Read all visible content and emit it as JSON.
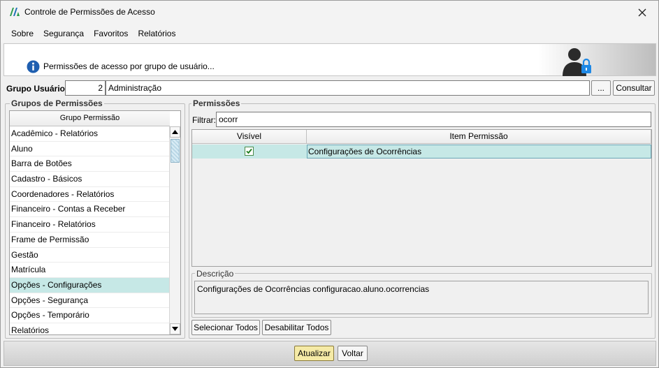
{
  "window": {
    "title": "Controle de Permissões de Acesso"
  },
  "menu": {
    "sobre": "Sobre",
    "seguranca": "Segurança",
    "favoritos": "Favoritos",
    "relatorios": "Relatórios"
  },
  "banner": {
    "text": "Permissões de acesso por grupo de usuário..."
  },
  "grupo_usuario": {
    "label": "Grupo Usuário:",
    "code": "2",
    "name": "Administração",
    "lookup_label": "...",
    "consultar_label": "Consultar"
  },
  "grupos": {
    "legend": "Grupos de Permissões",
    "column_header": "Grupo Permissão",
    "items": [
      "Acadêmico - Relatórios",
      "Aluno",
      "Barra de Botões",
      "Cadastro - Básicos",
      "Coordenadores - Relatórios",
      "Financeiro - Contas a Receber",
      "Financeiro - Relatórios",
      "Frame de Permissão",
      "Gestão",
      "Matrícula",
      "Opções - Configurações",
      "Opções - Segurança",
      "Opções - Temporário",
      "Relatórios"
    ],
    "selected_item": "Opções - Configurações"
  },
  "permissoes": {
    "legend": "Permissões",
    "filter_label": "Filtrar:",
    "filter_value": "ocorr",
    "columns": [
      "Visível",
      "Item Permissão"
    ],
    "rows": [
      {
        "visivel": true,
        "item": "Configurações de Ocorrências"
      }
    ]
  },
  "descricao": {
    "legend": "Descrição",
    "text": "Configurações de Ocorrências configuracao.aluno.ocorrencias"
  },
  "actions": {
    "selecionar_todos": "Selecionar Todos",
    "desabilitar_todos": "Desabilitar Todos",
    "atualizar": "Atualizar",
    "voltar": "Voltar"
  },
  "colors": {
    "selection": "#c6e8e6",
    "primary_button": "#f5eaa6",
    "info_icon": "#1f5fb0",
    "lock_icon": "#1e88e5"
  }
}
